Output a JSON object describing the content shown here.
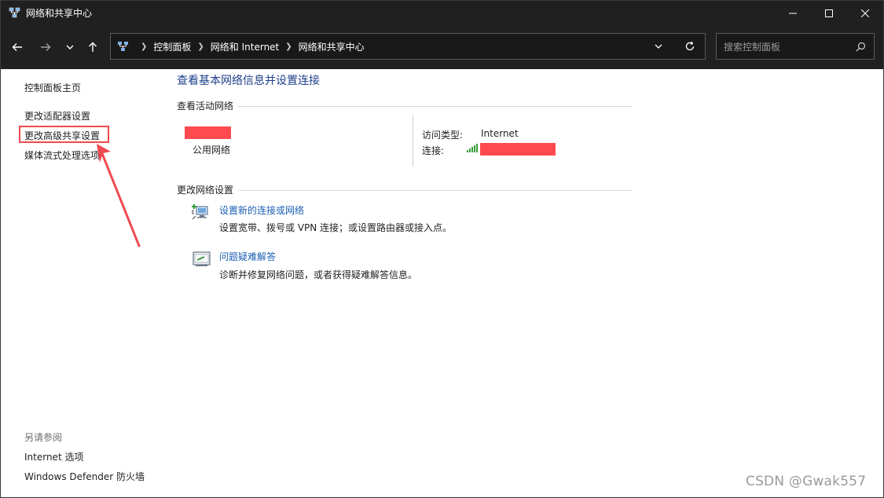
{
  "window": {
    "title": "网络和共享中心"
  },
  "address_bar": {
    "breadcrumbs": [
      "控制面板",
      "网络和 Internet",
      "网络和共享中心"
    ]
  },
  "search": {
    "placeholder": "搜索控制面板"
  },
  "sidebar": {
    "home_link": "控制面板主页",
    "links": [
      "更改适配器设置",
      "更改高级共享设置",
      "媒体流式处理选项"
    ],
    "see_also_heading": "另请参阅",
    "see_also_links": [
      "Internet 选项",
      "Windows Defender 防火墙"
    ]
  },
  "main": {
    "title": "查看基本网络信息并设置连接",
    "active_networks": {
      "heading": "查看活动网络",
      "network_type": "公用网络",
      "access_type_label": "访问类型:",
      "access_type_value": "Internet",
      "connection_label": "连接:"
    },
    "change_settings": {
      "heading": "更改网络设置",
      "tasks": [
        {
          "link": "设置新的连接或网络",
          "description": "设置宽带、拨号或 VPN 连接；或设置路由器或接入点。"
        },
        {
          "link": "问题疑难解答",
          "description": "诊断并修复网络问题，或者获得疑难解答信息。"
        }
      ]
    }
  },
  "watermark": "CSDN @Gwak557",
  "colors": {
    "titlebar": "#202020",
    "link_blue": "#1a5fb4",
    "title_blue": "#1e3f8a",
    "annotation_red": "#ee4a50",
    "redaction_red": "#ff4a50"
  }
}
